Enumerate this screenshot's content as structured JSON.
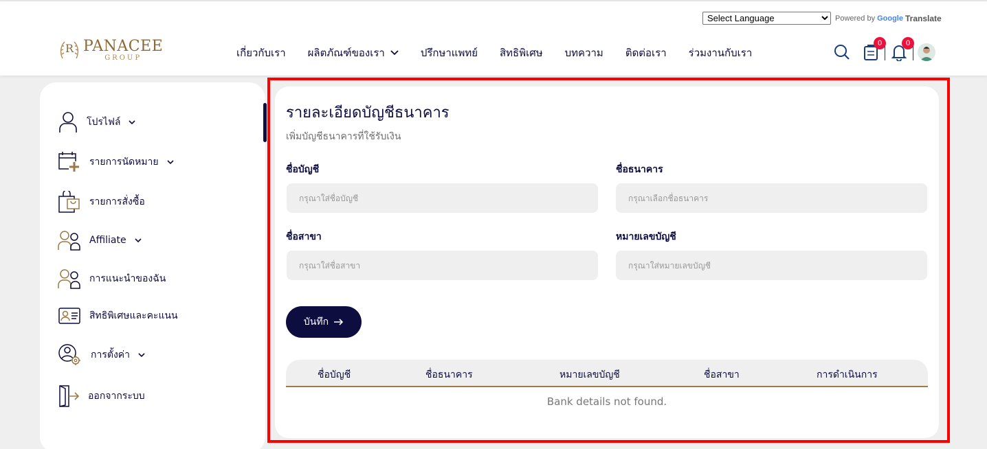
{
  "translate": {
    "select_value": "Select Language",
    "powered_by": "Powered by",
    "google": "Google",
    "translate_label": "Translate"
  },
  "header": {
    "logo_brand": "PANACEE",
    "logo_group": "GROUP",
    "logo_mark": "R",
    "nav": [
      {
        "label": "เกี่ยวกับเรา"
      },
      {
        "label": "ผลิตภัณฑ์ของเรา"
      },
      {
        "label": "ปรึกษาแพทย์"
      },
      {
        "label": "สิทธิพิเศษ"
      },
      {
        "label": "บทความ"
      },
      {
        "label": "ติดต่อเรา"
      },
      {
        "label": "ร่วมงานกับเรา"
      }
    ],
    "cart_count": "0",
    "notification_count": "0"
  },
  "sidebar": {
    "items": [
      {
        "label": "โปรไฟล์",
        "icon": "user-icon"
      },
      {
        "label": "รายการนัดหมาย",
        "icon": "calendar-plus-icon"
      },
      {
        "label": "รายการสั่งซื้อ",
        "icon": "shopping-bag-icon"
      },
      {
        "label": "Affiliate",
        "icon": "users-icon"
      },
      {
        "label": "การแนะนำของฉัน",
        "icon": "referral-icon"
      },
      {
        "label": "สิทธิพิเศษและคะแนน",
        "icon": "id-card-icon"
      },
      {
        "label": "การตั้งค่า",
        "icon": "user-settings-icon"
      },
      {
        "label": "ออกจากระบบ",
        "icon": "logout-icon"
      }
    ]
  },
  "main": {
    "title": "รายละเอียดบัญชีธนาคาร",
    "subtitle": "เพิ่มบัญชีธนาคารที่ใช้รับเงิน",
    "fields": {
      "account_name": {
        "label": "ชื่อบัญชี",
        "placeholder": "กรุณาใส่ชื่อบัญชี",
        "value": ""
      },
      "bank_name": {
        "label": "ชื่อธนาคาร",
        "placeholder": "กรุณาเลือกชื่อธนาคาร",
        "value": ""
      },
      "branch_name": {
        "label": "ชื่อสาขา",
        "placeholder": "กรุณาใส่ชื่อสาขา",
        "value": ""
      },
      "account_number": {
        "label": "หมายเลขบัญชี",
        "placeholder": "กรุณาใส่หมายเลขบัญชี",
        "value": ""
      }
    },
    "save_label": "บันทึก",
    "table": {
      "columns": [
        "ชื่อบัญชี",
        "ชื่อธนาคาร",
        "หมายเลขบัญชี",
        "ชื่อสาขา",
        "การดำเนินการ"
      ],
      "empty_message": "Bank details not found."
    }
  },
  "colors": {
    "primary": "#0d0d40",
    "gold": "#9b7a47",
    "badge": "#e8123c",
    "highlight": "#ff0000"
  }
}
